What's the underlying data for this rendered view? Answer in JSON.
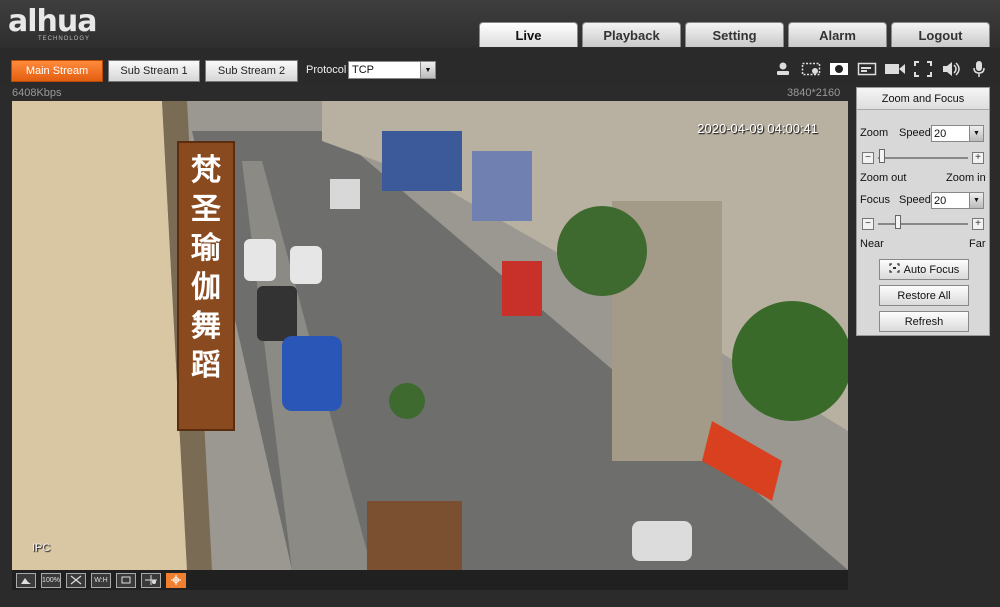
{
  "brand": {
    "name": "alhua",
    "tagline": "TECHNOLOGY"
  },
  "nav": [
    {
      "label": "Live",
      "active": true
    },
    {
      "label": "Playback"
    },
    {
      "label": "Setting"
    },
    {
      "label": "Alarm"
    },
    {
      "label": "Logout"
    }
  ],
  "toolbar": {
    "main_stream": "Main Stream",
    "sub_stream_1": "Sub Stream 1",
    "sub_stream_2": "Sub Stream 2",
    "protocol_label": "Protocol",
    "protocol_value": "TCP",
    "icons": [
      "person-icon",
      "region-icon",
      "snapshot-icon",
      "card-icon",
      "record-icon",
      "fullscreen-icon",
      "speaker-icon",
      "microphone-icon"
    ]
  },
  "status": {
    "bitrate": "6408Kbps",
    "resolution": "3840*2160"
  },
  "video": {
    "timestamp": "2020-04-09 04:00:41",
    "osd_label": "IPC",
    "sign_chars": [
      "梵",
      "圣",
      "瑜",
      "伽",
      "舞",
      "蹈"
    ]
  },
  "video_bar": [
    {
      "icon": "image-adjust-icon",
      "text": ""
    },
    {
      "icon": "original-size-icon",
      "text": "100%"
    },
    {
      "icon": "fit-icon",
      "text": ""
    },
    {
      "icon": "width-height-icon",
      "text": "W:H"
    },
    {
      "icon": "zoom-icon",
      "text": ""
    },
    {
      "icon": "ptz-icon",
      "text": ""
    },
    {
      "icon": "fisheye-icon",
      "text": "",
      "active": true
    }
  ],
  "zoom_focus": {
    "title": "Zoom and Focus",
    "zoom_label": "Zoom",
    "speed_label": "Speed",
    "zoom_speed": "20",
    "zoom_out": "Zoom out",
    "zoom_in": "Zoom in",
    "focus_label": "Focus",
    "focus_speed": "20",
    "near": "Near",
    "far": "Far",
    "auto_focus": "Auto Focus",
    "restore_all": "Restore All",
    "refresh": "Refresh"
  },
  "colors": {
    "accent": "#f07020",
    "panel": "#d8d8d8"
  }
}
